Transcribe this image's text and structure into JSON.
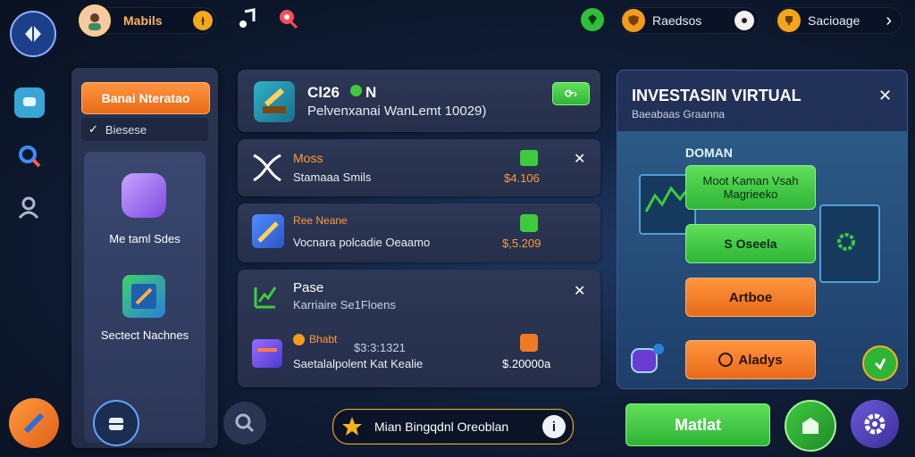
{
  "topbar": {
    "player_name": "Mabils",
    "coin_symbol": "Ɨ",
    "right_pill_1": "Raedsos",
    "right_pill_2": "Sacioage",
    "chevron": "›"
  },
  "left_menu": {
    "header_button": "Banai Nteratao",
    "check_item": "Biesese",
    "tile_1_label": "Me taml Sdes",
    "tile_2_label": "Sectect Nachnes"
  },
  "list": {
    "hero": {
      "title": "Cl26",
      "title_suffix": "N",
      "subtitle": "Pelvenxanai WanLemt 10029)"
    },
    "rows": [
      {
        "title": "Moss",
        "subtitle": "Stamaaa Smils",
        "price": "$4.106"
      },
      {
        "title": "Ree Neane",
        "subtitle": "Vocnara polcadie Oeaamo",
        "price": "$,5.209"
      },
      {
        "title": "Pase",
        "subtitle": "Karriaire Se1Floens",
        "price": ""
      },
      {
        "title": "Bhabt",
        "title_extra": "$3:3:1321",
        "subtitle": "Saetalalpolent Kat Kealie",
        "price": "$.20000a"
      }
    ]
  },
  "invest_panel": {
    "title": "INVESTASIN VIRTUAL",
    "subtitle": "Baeabaas Graanna",
    "section_label": "DOMAN",
    "button_1": "Moot Kaman Vsah Magrieeko",
    "button_2": "S Oseela",
    "button_3": "Artboe",
    "button_4": "Aladys"
  },
  "bottombar": {
    "search_pill": "Mian Bingqdnl Oreoblan",
    "info": "i",
    "main_button": "Matlat"
  },
  "colors": {
    "accent_green": "#3fca3e",
    "accent_orange": "#f07a22",
    "panel": "#262f4a"
  }
}
